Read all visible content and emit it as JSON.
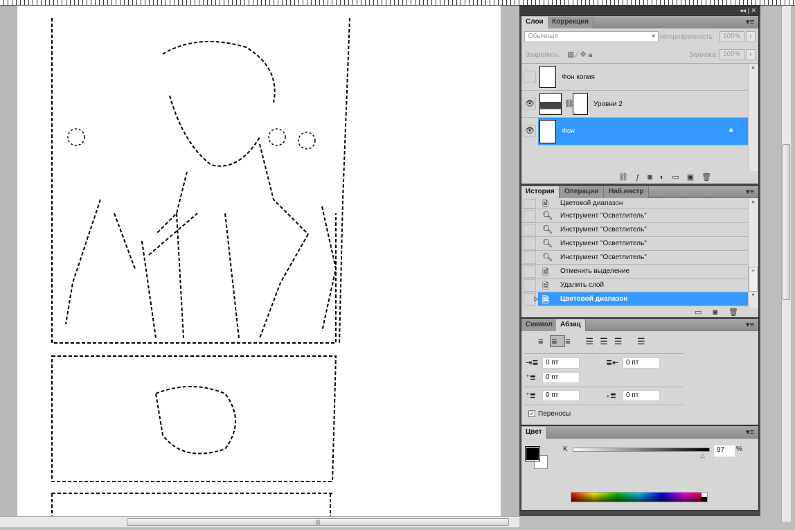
{
  "window": {
    "controls": "◂◂ | ✕"
  },
  "layers_panel": {
    "tabs": [
      "Слои",
      "Коррекция"
    ],
    "blend_mode": "Обычные",
    "opacity_label": "Непрозрачность:",
    "opacity_value": "100%",
    "lock_label": "Закрепить:",
    "fill_label": "Заливка:",
    "fill_value": "100%",
    "layers": [
      {
        "name": "Фон копия",
        "visible": false,
        "selected": false
      },
      {
        "name": "Уровни 2",
        "visible": true,
        "selected": false
      },
      {
        "name": "Фон",
        "visible": true,
        "selected": true,
        "locked": true
      }
    ],
    "footer_icons": [
      "link-icon",
      "fx-icon",
      "mask-icon",
      "adjustment-icon",
      "folder-icon",
      "new-layer-icon",
      "trash-icon"
    ]
  },
  "history_panel": {
    "tabs": [
      "История",
      "Операции",
      "Наб.инстр"
    ],
    "items": [
      {
        "label": "Цветовой диапазон",
        "icon": "document-icon"
      },
      {
        "label": "Инструмент \"Осветлитель\"",
        "icon": "dodge-icon"
      },
      {
        "label": "Инструмент \"Осветлитель\"",
        "icon": "dodge-icon"
      },
      {
        "label": "Инструмент \"Осветлитель\"",
        "icon": "dodge-icon"
      },
      {
        "label": "Инструмент \"Осветлитель\"",
        "icon": "dodge-icon"
      },
      {
        "label": "Отменить выделение",
        "icon": "document-icon"
      },
      {
        "label": "Удалить слой",
        "icon": "document-icon"
      },
      {
        "label": "Цветовой диапазон",
        "icon": "document-icon",
        "selected": true
      }
    ]
  },
  "paragraph_panel": {
    "tabs": [
      "Символ",
      "Абзац"
    ],
    "indent_left": "0 пт",
    "indent_right": "0 пт",
    "indent_first": "0 пт",
    "space_before": "0 пт",
    "space_after": "0 пт",
    "hyphenation_label": "Переносы",
    "hyphenation_checked": true,
    "selected_alignment": "center"
  },
  "color_panel": {
    "tab": "Цвет",
    "channel_label": "K",
    "value": "97",
    "unit": "%",
    "foreground": "#000000",
    "background": "#ffffff"
  },
  "colors": {
    "selection": "#3399ff",
    "panel": "#d6d6d6"
  }
}
